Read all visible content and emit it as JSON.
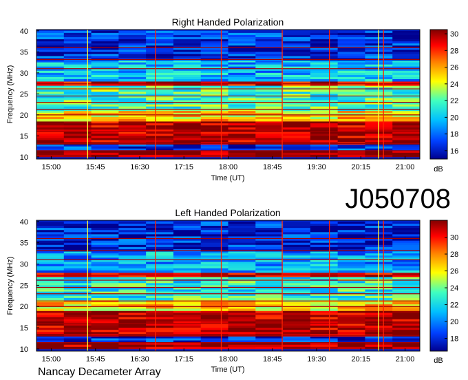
{
  "observation_id": "J050708",
  "credit": "Nancay Decameter Array",
  "chart_data": [
    {
      "type": "heatmap",
      "title": "Right Handed Polarization",
      "xlabel": "Time (UT)",
      "ylabel": "Frequency (MHz)",
      "x_ticks": [
        "15:00",
        "15:45",
        "16:30",
        "17:15",
        "18:00",
        "18:45",
        "19:30",
        "20:15",
        "21:00"
      ],
      "x_range": [
        "14:45",
        "21:15"
      ],
      "y_ticks": [
        10,
        15,
        20,
        25,
        30,
        35,
        40
      ],
      "ylim": [
        9.5,
        40.3
      ],
      "colorbar": {
        "label": "dB",
        "ticks": [
          16,
          18,
          20,
          22,
          24,
          26,
          28,
          30
        ],
        "range": [
          15,
          30.5
        ]
      },
      "colormap": [
        "#00008f",
        "#0040ff",
        "#00bfff",
        "#40ffbf",
        "#ffff00",
        "#ff8000",
        "#ff0000",
        "#800000"
      ],
      "bands": [
        {
          "freq": [
            10,
            11.5
          ],
          "level": 30
        },
        {
          "freq": [
            11.5,
            13
          ],
          "level": 17
        },
        {
          "freq": [
            13,
            18.5
          ],
          "level": 29.5
        },
        {
          "freq": [
            18.5,
            21
          ],
          "level": 24.5
        },
        {
          "freq": [
            21,
            27
          ],
          "level": 21.5
        },
        {
          "freq": [
            27,
            28
          ],
          "level": 29
        },
        {
          "freq": [
            28,
            33
          ],
          "level": 19.5
        },
        {
          "freq": [
            33,
            40
          ],
          "level": 16.8
        }
      ],
      "interference_lines_mhz": [
        11.5,
        13.2,
        16,
        20,
        21.3,
        23,
        24.5,
        26.2,
        27.4,
        31,
        33.2,
        36
      ],
      "vertical_events": [
        {
          "time": "15:37",
          "color": "#ffff33"
        },
        {
          "time": "16:46",
          "color": "#ff2200"
        },
        {
          "time": "17:53",
          "color": "#ff2200"
        },
        {
          "time": "18:55",
          "color": "#ff2200"
        },
        {
          "time": "19:43",
          "color": "#ff2200"
        },
        {
          "time": "20:33",
          "color": "#ffff33"
        },
        {
          "time": "20:38",
          "color": "#ff2200"
        }
      ]
    },
    {
      "type": "heatmap",
      "title": "Left Handed Polarization",
      "xlabel": "Time (UT)",
      "ylabel": "Frequency (MHz)",
      "x_ticks": [
        "15:00",
        "15:45",
        "16:30",
        "17:15",
        "18:00",
        "18:45",
        "19:30",
        "20:15",
        "21:00"
      ],
      "x_range": [
        "14:45",
        "21:15"
      ],
      "y_ticks": [
        10,
        15,
        20,
        25,
        30,
        35,
        40
      ],
      "ylim": [
        9.5,
        40.3
      ],
      "colorbar": {
        "label": "dB",
        "ticks": [
          18,
          20,
          22,
          24,
          26,
          28,
          30
        ],
        "range": [
          16.5,
          32
        ]
      },
      "colormap": [
        "#00008f",
        "#0040ff",
        "#00bfff",
        "#40ffbf",
        "#ffff00",
        "#ff8000",
        "#ff0000",
        "#800000"
      ],
      "bands": [
        {
          "freq": [
            10,
            11.5
          ],
          "level": 31.5
        },
        {
          "freq": [
            11.5,
            13
          ],
          "level": 18
        },
        {
          "freq": [
            13,
            19
          ],
          "level": 31
        },
        {
          "freq": [
            19,
            21.5
          ],
          "level": 26
        },
        {
          "freq": [
            21.5,
            27
          ],
          "level": 22.5
        },
        {
          "freq": [
            27,
            28
          ],
          "level": 30.5
        },
        {
          "freq": [
            28,
            33
          ],
          "level": 20.5
        },
        {
          "freq": [
            33,
            40
          ],
          "level": 18
        }
      ],
      "interference_lines_mhz": [
        11.5,
        13.2,
        16,
        20,
        21.3,
        23,
        24.5,
        26.2,
        27.4,
        31,
        33.2,
        36
      ],
      "vertical_events": [
        {
          "time": "15:37",
          "color": "#ffff33"
        },
        {
          "time": "16:46",
          "color": "#ff2200"
        },
        {
          "time": "17:53",
          "color": "#ff2200"
        },
        {
          "time": "18:55",
          "color": "#ff2200"
        },
        {
          "time": "19:43",
          "color": "#ff2200"
        },
        {
          "time": "20:33",
          "color": "#ffff33"
        },
        {
          "time": "20:38",
          "color": "#ff2200"
        }
      ]
    }
  ]
}
